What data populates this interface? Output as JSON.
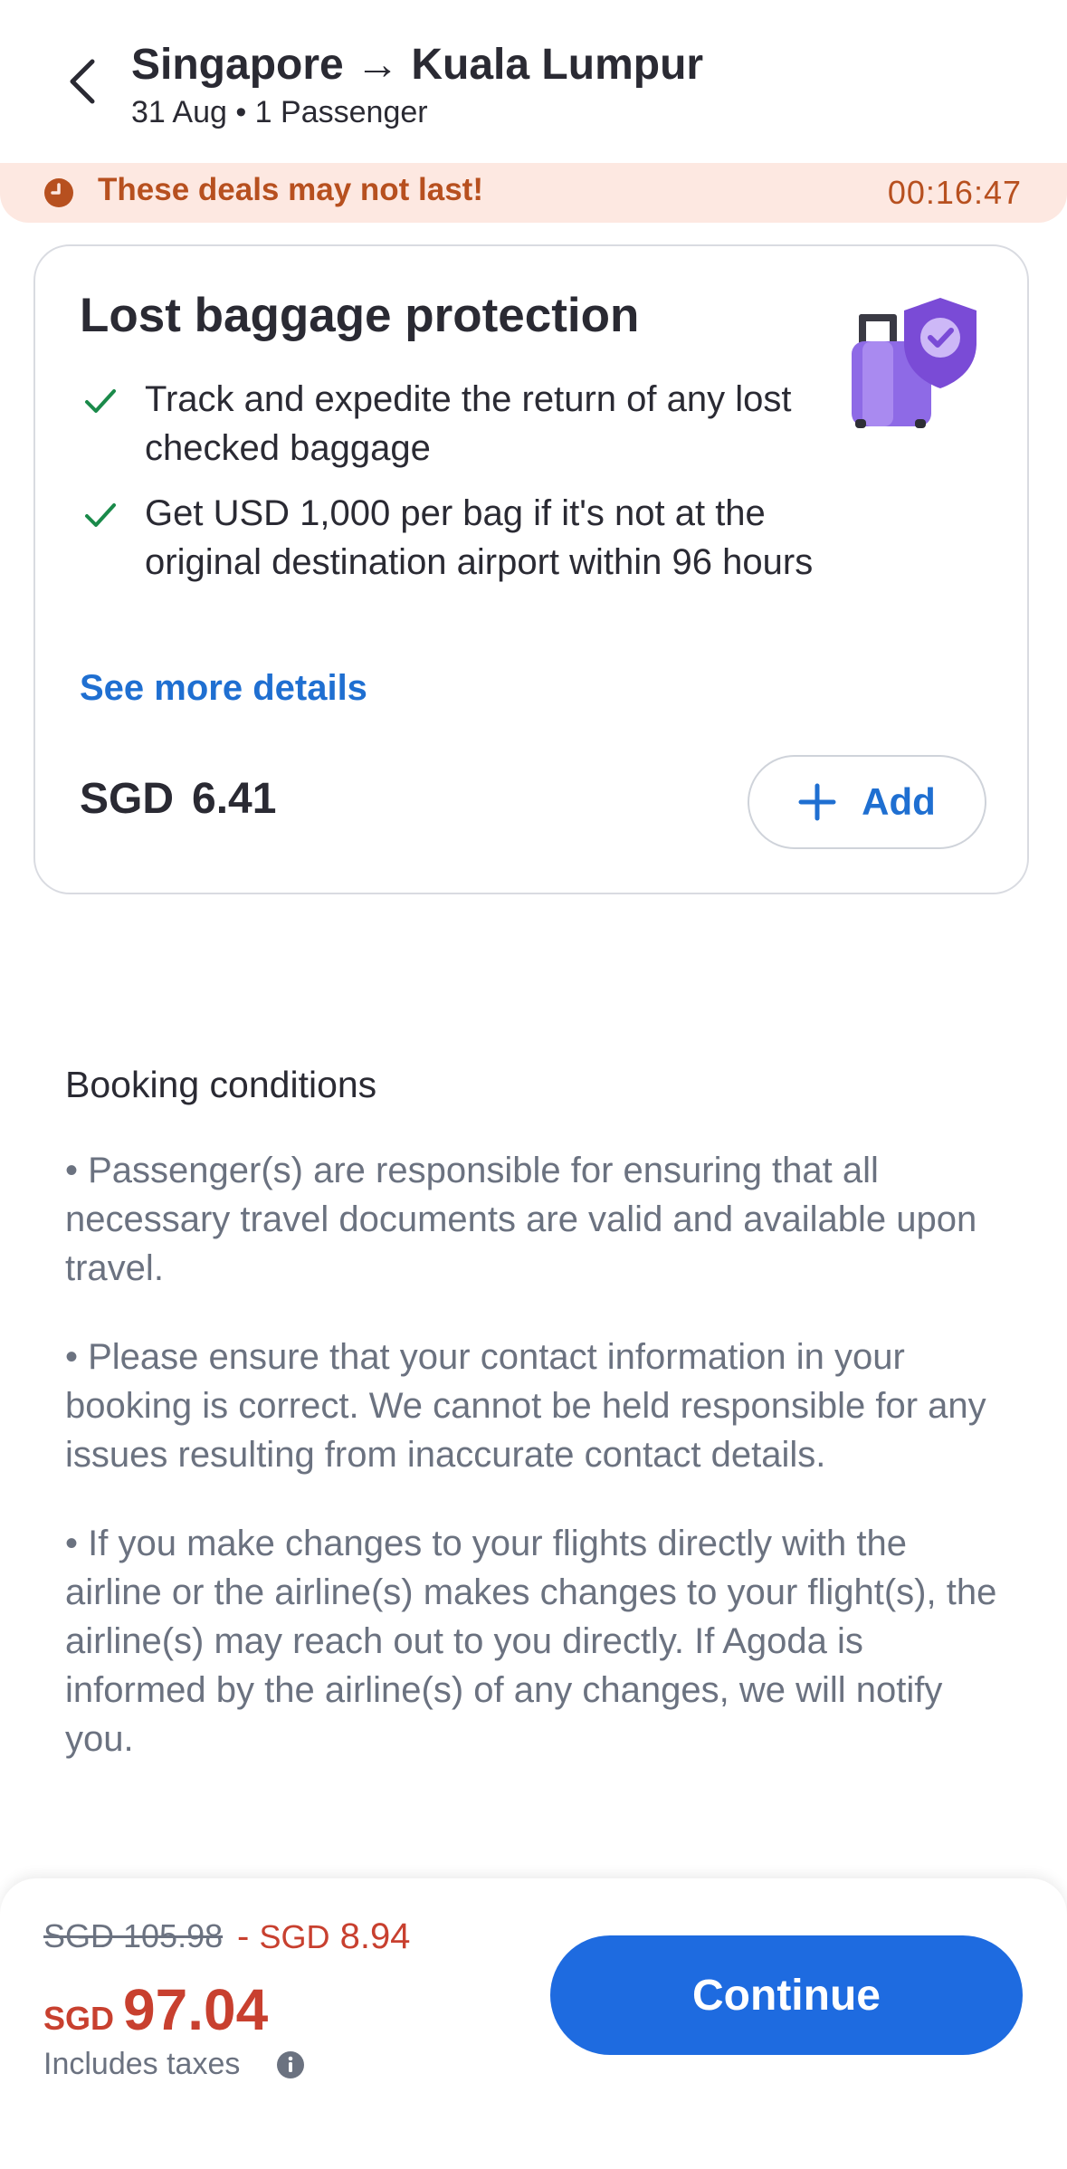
{
  "header": {
    "title": "Singapore → Kuala Lumpur",
    "subtitle": "31 Aug • 1 Passenger",
    "back_icon": "chevron-left-icon"
  },
  "deal_banner": {
    "icon": "clock-icon",
    "text": "These deals may not last!",
    "timer": "00:16:47",
    "color": "#b7501f",
    "background": "#fde8e1"
  },
  "protection_card": {
    "title": "Lost baggage protection",
    "illustration": "suitcase-shield-icon",
    "benefits": [
      {
        "icon": "check-icon",
        "text": "Track and expedite the return of any lost checked baggage"
      },
      {
        "icon": "check-icon",
        "text": "Get USD 1,000 per bag if it's not at the original destination airport within 96 hours"
      }
    ],
    "see_more": "See more details",
    "price_currency": "SGD",
    "price_amount": "6.41",
    "add_label": "Add"
  },
  "booking_conditions": {
    "heading": "Booking conditions",
    "items": [
      "• Passenger(s) are responsible for ensuring that all necessary travel documents are valid and available upon travel.",
      "• Please ensure that your contact information in your booking is correct. We cannot be held responsible for any issues resulting from inaccurate contact details.",
      "• If you make changes to your flights directly with the airline or the airline(s) makes changes to your flight(s), the airline(s) may reach out to you directly. If Agoda is informed by the airline(s) of any changes, we will notify you."
    ]
  },
  "footer": {
    "original_price": "SGD 105.98",
    "discount_prefix": "- ",
    "discount_currency": "SGD",
    "discount_amount": "8.94",
    "final_currency": "SGD",
    "final_amount": "97.04",
    "taxes_note": "Includes taxes",
    "continue_label": "Continue"
  },
  "colors": {
    "accent_blue": "#1e6be0",
    "link_blue": "#1f6fd1",
    "price_red": "#c8402f",
    "check_green": "#1a8a4a"
  }
}
